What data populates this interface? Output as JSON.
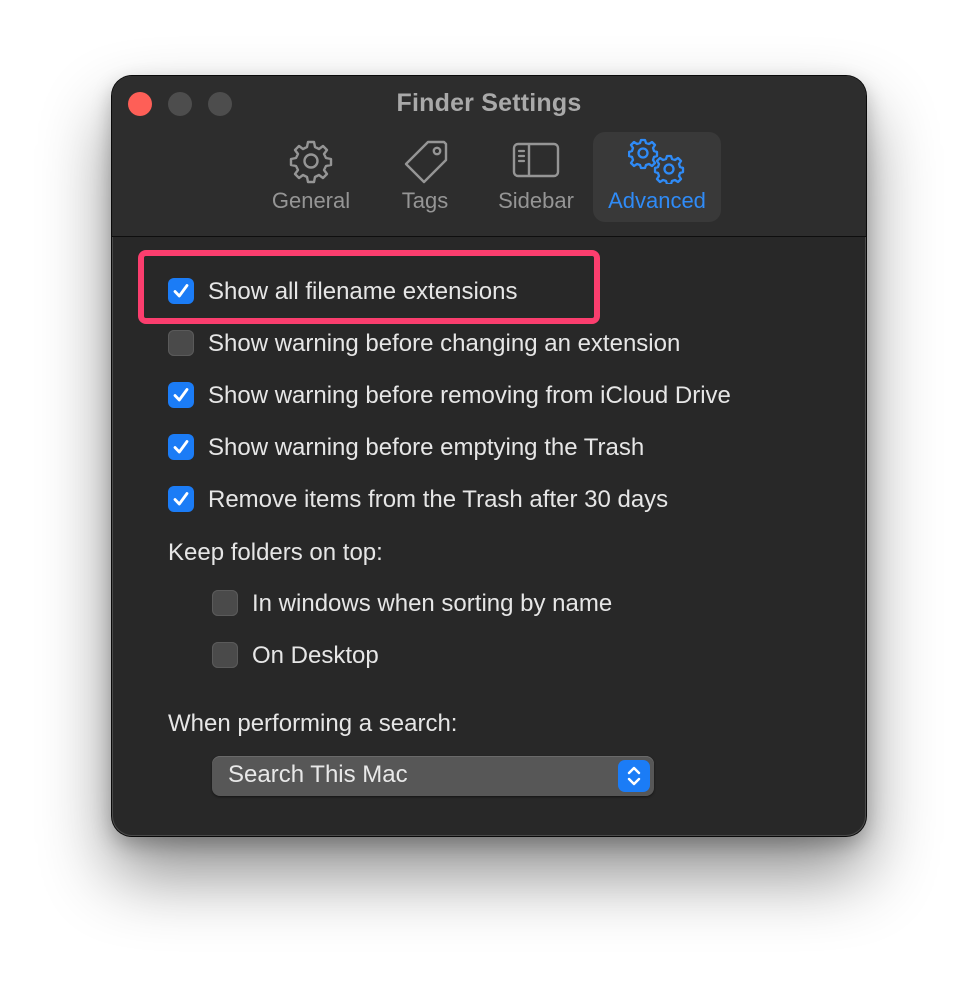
{
  "window": {
    "title": "Finder Settings"
  },
  "tabs": [
    {
      "label": "General",
      "icon": "gear-icon",
      "active": false
    },
    {
      "label": "Tags",
      "icon": "tag-icon",
      "active": false
    },
    {
      "label": "Sidebar",
      "icon": "sidebar-icon",
      "active": false
    },
    {
      "label": "Advanced",
      "icon": "gears-icon",
      "active": true
    }
  ],
  "options": [
    {
      "label": "Show all filename extensions",
      "checked": true
    },
    {
      "label": "Show warning before changing an extension",
      "checked": false
    },
    {
      "label": "Show warning before removing from iCloud Drive",
      "checked": true
    },
    {
      "label": "Show warning before emptying the Trash",
      "checked": true
    },
    {
      "label": "Remove items from the Trash after 30 days",
      "checked": true
    }
  ],
  "folders_section": {
    "heading": "Keep folders on top:",
    "options": [
      {
        "label": "In windows when sorting by name",
        "checked": false
      },
      {
        "label": "On Desktop",
        "checked": false
      }
    ]
  },
  "search_section": {
    "heading": "When performing a search:",
    "selected": "Search This Mac"
  },
  "colors": {
    "accent": "#2f8bf7",
    "checkbox_on": "#1b7cf6",
    "highlight": "#fb3e6e",
    "close_button": "#fe5f57",
    "window_bg": "#282828"
  }
}
